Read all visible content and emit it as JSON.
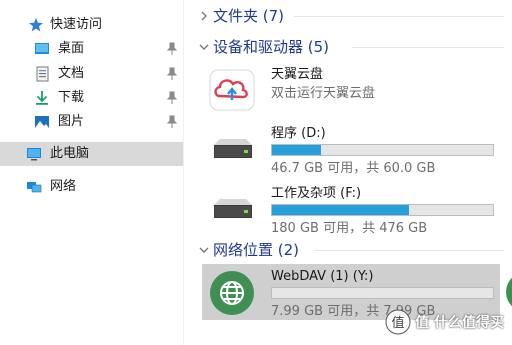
{
  "sidebar": {
    "quick_access": {
      "label": "快速访问",
      "icon": "star-icon"
    },
    "pinned": [
      {
        "label": "桌面",
        "icon": "desktop-icon"
      },
      {
        "label": "文档",
        "icon": "document-icon"
      },
      {
        "label": "下载",
        "icon": "download-icon"
      },
      {
        "label": "图片",
        "icon": "pictures-icon"
      }
    ],
    "this_pc": {
      "label": "此电脑",
      "icon": "monitor-icon"
    },
    "network": {
      "label": "网络",
      "icon": "network-icon"
    }
  },
  "main": {
    "folders": {
      "title": "文件夹 (7)"
    },
    "devices": {
      "title": "设备和驱动器 (5)",
      "items": [
        {
          "name": "天翼云盘",
          "subtitle": "双击运行天翼云盘",
          "icon": "tianyi-cloud-icon"
        },
        {
          "name": "程序 (D:)",
          "free_text": "46.7 GB 可用，共 60.0 GB",
          "used_fraction": 0.22,
          "icon": "hard-drive-icon"
        },
        {
          "name": "工作及杂项 (F:)",
          "free_text": "180 GB 可用，共 476 GB",
          "used_fraction": 0.62,
          "icon": "hard-drive-icon"
        }
      ]
    },
    "network_locations": {
      "title": "网络位置 (2)",
      "items": [
        {
          "name": "WebDAV (1) (Y:)",
          "free_text": "7.99 GB 可用，共 7.99 GB",
          "used_fraction": 0.0,
          "icon": "globe-icon"
        }
      ]
    }
  },
  "watermark": {
    "text": "值 什么值得买"
  },
  "colors": {
    "accent": "#1f3a93",
    "bar_fill": "#26a0da",
    "selected": "#d9d9d9"
  }
}
